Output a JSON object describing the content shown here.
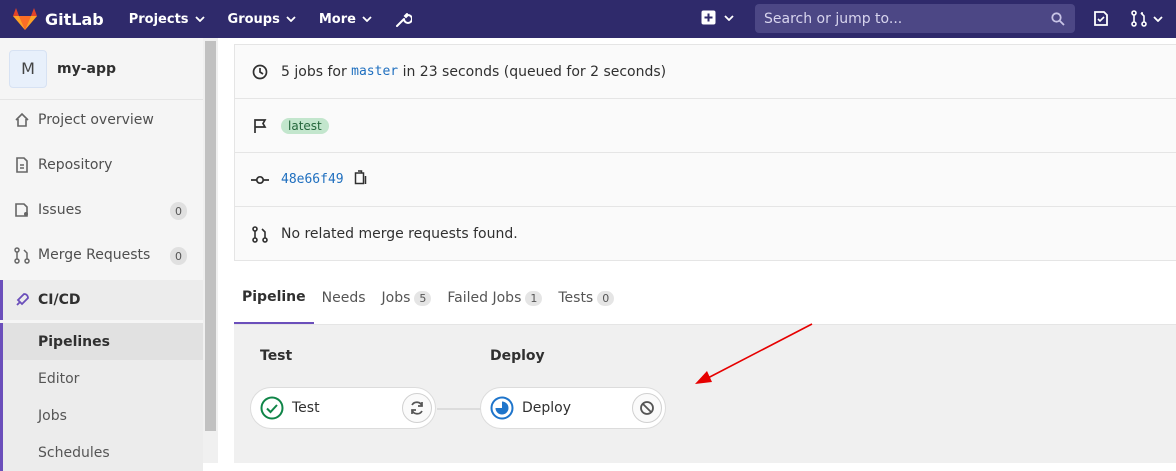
{
  "topnav": {
    "brand": "GitLab",
    "menus": [
      {
        "label": "Projects"
      },
      {
        "label": "Groups"
      },
      {
        "label": "More"
      }
    ],
    "search_placeholder": "Search or jump to..."
  },
  "sidebar": {
    "project_initial": "M",
    "project_name": "my-app",
    "items": [
      {
        "label": "Project overview",
        "icon": "home-icon"
      },
      {
        "label": "Repository",
        "icon": "document-icon"
      },
      {
        "label": "Issues",
        "icon": "issues-icon",
        "count": "0"
      },
      {
        "label": "Merge Requests",
        "icon": "merge-request-icon",
        "count": "0"
      },
      {
        "label": "CI/CD",
        "icon": "rocket-icon"
      }
    ],
    "sub_items": [
      "Pipelines",
      "Editor",
      "Jobs",
      "Schedules"
    ]
  },
  "info": {
    "jobs_prefix": "5 jobs for",
    "branch": "master",
    "jobs_suffix": "in 23 seconds (queued for 2 seconds)",
    "tag": "latest",
    "commit": "48e66f49",
    "mr_text": "No related merge requests found."
  },
  "tabs": [
    {
      "label": "Pipeline"
    },
    {
      "label": "Needs"
    },
    {
      "label": "Jobs",
      "count": "5"
    },
    {
      "label": "Failed Jobs",
      "count": "1"
    },
    {
      "label": "Tests",
      "count": "0"
    }
  ],
  "stages": [
    {
      "title": "Test",
      "job": "Test",
      "status": "success",
      "action": "retry-icon"
    },
    {
      "title": "Deploy",
      "job": "Deploy",
      "status": "running",
      "action": "cancel-icon"
    }
  ],
  "colors": {
    "nav_bg": "#2f2a6b",
    "accent": "#6b4fbb",
    "success": "#108548",
    "running": "#1f75cb",
    "annotation_arrow": "#e60000"
  }
}
